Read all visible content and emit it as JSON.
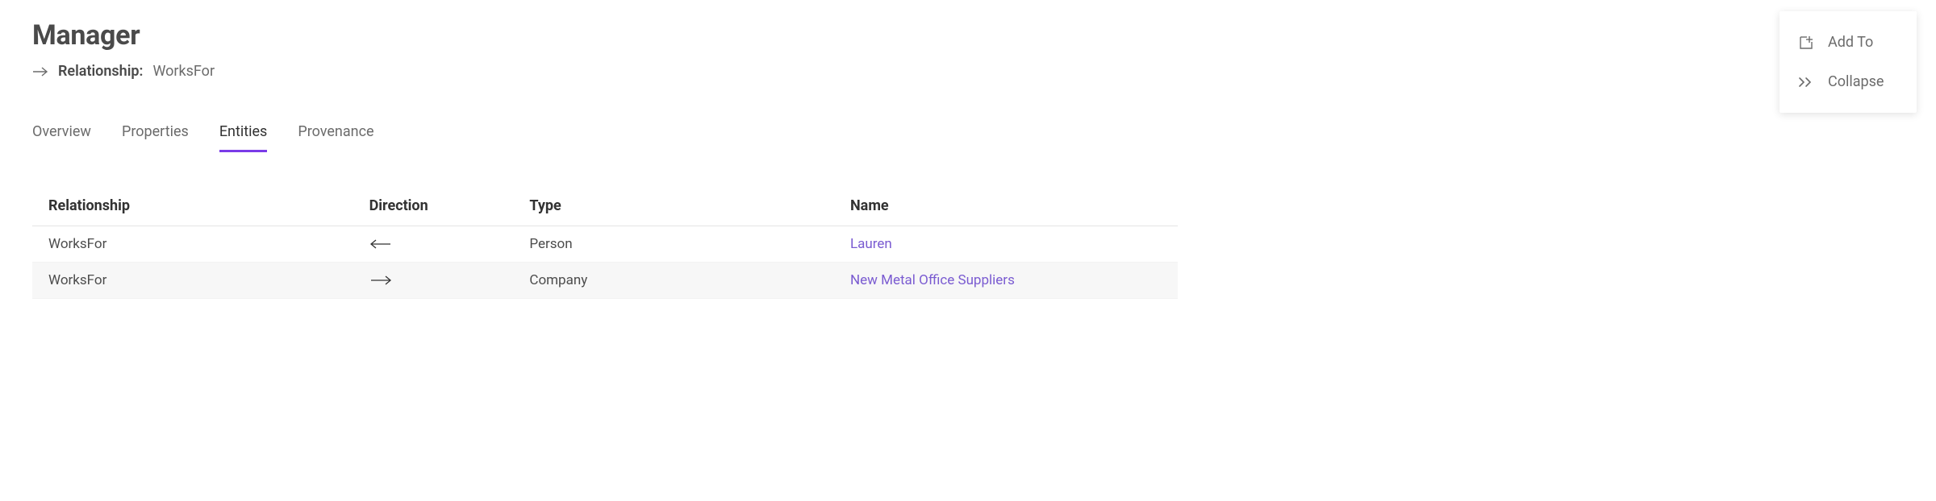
{
  "header": {
    "title": "Manager",
    "subtitle_label": "Relationship:",
    "subtitle_value": "WorksFor"
  },
  "tabs": [
    {
      "label": "Overview",
      "active": false
    },
    {
      "label": "Properties",
      "active": false
    },
    {
      "label": "Entities",
      "active": true
    },
    {
      "label": "Provenance",
      "active": false
    }
  ],
  "table": {
    "columns": [
      "Relationship",
      "Direction",
      "Type",
      "Name"
    ],
    "rows": [
      {
        "relationship": "WorksFor",
        "direction": "back",
        "type": "Person",
        "name": "Lauren"
      },
      {
        "relationship": "WorksFor",
        "direction": "forward",
        "type": "Company",
        "name": "New Metal Office Suppliers"
      }
    ]
  },
  "actions": {
    "add_to_label": "Add To",
    "collapse_label": "Collapse"
  },
  "colors": {
    "accent": "#7a3be8",
    "link": "#7a5bd1"
  }
}
